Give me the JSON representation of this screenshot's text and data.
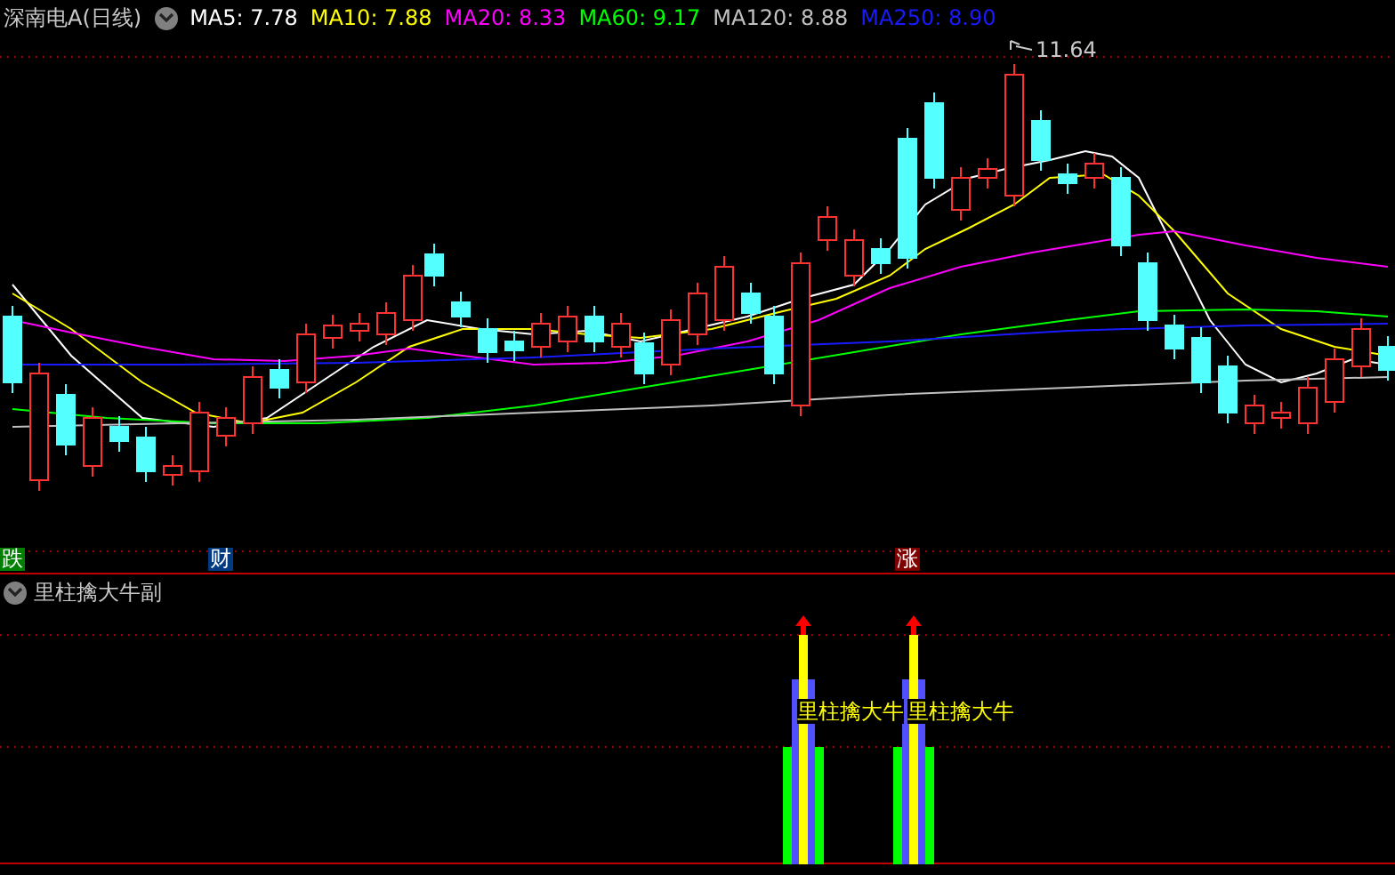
{
  "header": {
    "title": "深南电A(日线)",
    "indicators": [
      {
        "label": "MA5: 7.78",
        "color": "#ffffff"
      },
      {
        "label": "MA10: 7.88",
        "color": "#ffff00"
      },
      {
        "label": "MA20: 8.33",
        "color": "#ff00ff"
      },
      {
        "label": "MA60: 9.17",
        "color": "#00ff00"
      },
      {
        "label": "MA120: 8.88",
        "color": "#c0c0c0"
      },
      {
        "label": "MA250: 8.90",
        "color": "#1a1aff"
      }
    ]
  },
  "price_chart": {
    "high_label": "11.64"
  },
  "markers": [
    {
      "label": "跌",
      "color": "#008000"
    },
    {
      "label": "财",
      "color": "#003a80"
    },
    {
      "label": "涨",
      "color": "#800000"
    }
  ],
  "sub_panel": {
    "title": "里柱擒大牛副",
    "signals": [
      {
        "label": "里柱擒大牛"
      },
      {
        "label": "里柱擒大牛"
      }
    ]
  }
}
